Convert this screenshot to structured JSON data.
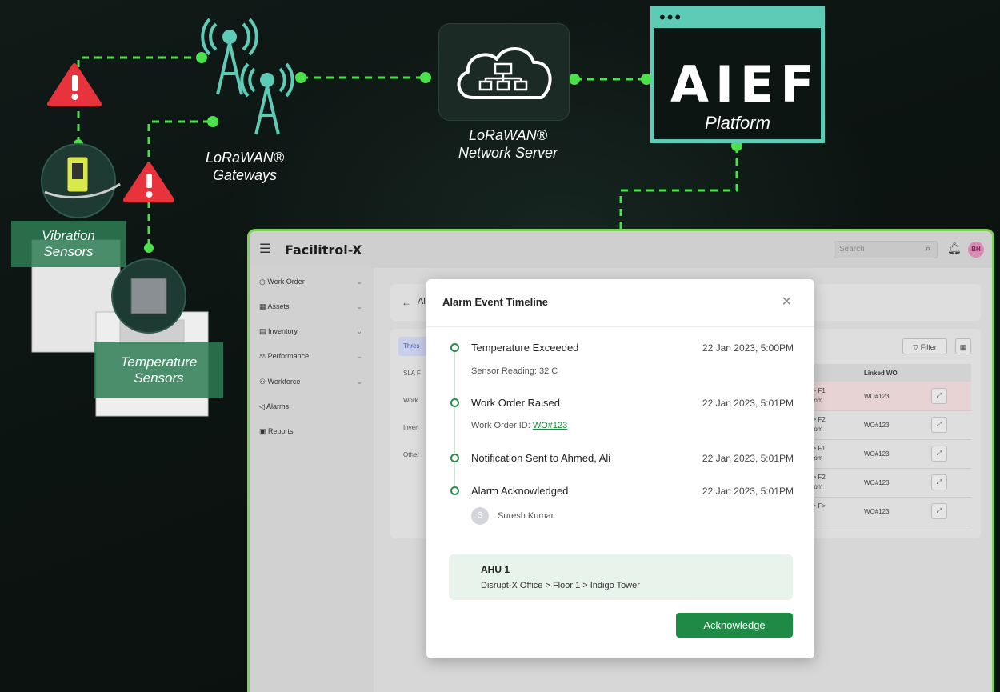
{
  "diagram": {
    "gateways_label": [
      "LoRaWAN®",
      "Gateways"
    ],
    "network_server_label": [
      "LoRaWAN®",
      "Network Server"
    ],
    "platform_logo": "AIEF",
    "platform_label": "Platform",
    "vibration_label": [
      "Vibration",
      "Sensors"
    ],
    "temperature_label": [
      "Temperature",
      "Sensors"
    ],
    "accent_color": "#5ecbb7",
    "link_color": "#4de04d"
  },
  "app": {
    "logo": "Facilitrol-X",
    "search_placeholder": "Search",
    "user_initials": "BH",
    "sidebar": [
      {
        "label": "Work Order",
        "icon": "clipboard-icon",
        "has_chevron": true
      },
      {
        "label": "Assets",
        "icon": "grid-icon",
        "has_chevron": true
      },
      {
        "label": "Inventory",
        "icon": "box-icon",
        "has_chevron": true
      },
      {
        "label": "Performance",
        "icon": "chart-icon",
        "has_chevron": true
      },
      {
        "label": "Workforce",
        "icon": "people-icon",
        "has_chevron": true
      },
      {
        "label": "Alarms",
        "icon": "alarm-icon",
        "has_chevron": false
      },
      {
        "label": "Reports",
        "icon": "report-icon",
        "has_chevron": false
      }
    ],
    "back_title": "Al",
    "tabs": [
      "Thres",
      "SLA F",
      "Work",
      "Inven",
      "Other"
    ],
    "filter_label": "Filter",
    "linked_wo_header": "Linked WO",
    "rows": [
      {
        "loc": [
          "ower > F1",
          "ng Room"
        ],
        "wo": "WO#123",
        "highlight": true
      },
      {
        "loc": [
          "ower > F2",
          "ng Room"
        ],
        "wo": "WO#123",
        "highlight": false
      },
      {
        "loc": [
          "ower > F1",
          "ng Room"
        ],
        "wo": "WO#123",
        "highlight": false
      },
      {
        "loc": [
          "ower > F2",
          "ng Room"
        ],
        "wo": "WO#123",
        "highlight": false
      },
      {
        "loc": [
          "ower > F>",
          "Room"
        ],
        "wo": "WO#123",
        "highlight": false
      }
    ]
  },
  "modal": {
    "title": "Alarm Event Timeline",
    "events": [
      {
        "title": "Temperature Exceeded",
        "time": "22 Jan 2023, 5:00PM",
        "sub": "Sensor Reading: 32 C"
      },
      {
        "title": "Work Order Raised",
        "time": "22 Jan 2023, 5:01PM",
        "sub_prefix": "Work Order ID: ",
        "sub_link": "WO#123"
      },
      {
        "title": "Notification Sent to Ahmed, Ali",
        "time": "22 Jan 2023, 5:01PM"
      },
      {
        "title": "Alarm Acknowledged",
        "time": "22 Jan 2023, 5:01PM",
        "user_initial": "S",
        "user_name": "Suresh Kumar"
      }
    ],
    "asset_name": "AHU 1",
    "asset_location": "Disrupt-X Office > Floor 1 > Indigo Tower",
    "button_label": "Acknowledge"
  }
}
